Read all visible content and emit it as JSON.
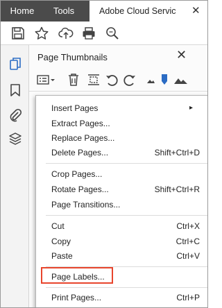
{
  "tabs": {
    "home": "Home",
    "tools": "Tools",
    "document": "Adobe Cloud Servic",
    "close": "✕"
  },
  "toolbar": {
    "icons": [
      "save-icon",
      "star-icon",
      "upload-cloud-icon",
      "print-icon",
      "zoom-search-icon"
    ]
  },
  "rail": {
    "icons": [
      "page-thumbnails-icon",
      "bookmark-icon",
      "attachment-icon",
      "layers-icon"
    ]
  },
  "panel": {
    "title": "Page Thumbnails",
    "close": "✕",
    "tools": [
      "options-menu-icon",
      "delete-icon",
      "insert-pages-icon",
      "rotate-left-icon",
      "rotate-right-icon",
      "small-thumbnails-icon",
      "thumbnail-size-slider-icon",
      "large-thumbnails-icon"
    ]
  },
  "menu": {
    "items": [
      {
        "label": "Insert Pages",
        "shortcut": "",
        "submenu": "▸"
      },
      {
        "label": "Extract Pages...",
        "shortcut": ""
      },
      {
        "label": "Replace Pages...",
        "shortcut": ""
      },
      {
        "label": "Delete Pages...",
        "shortcut": "Shift+Ctrl+D"
      },
      {
        "label": "Crop Pages...",
        "shortcut": ""
      },
      {
        "label": "Rotate Pages...",
        "shortcut": "Shift+Ctrl+R"
      },
      {
        "label": "Page Transitions...",
        "shortcut": ""
      },
      {
        "label": "Cut",
        "shortcut": "Ctrl+X"
      },
      {
        "label": "Copy",
        "shortcut": "Ctrl+C"
      },
      {
        "label": "Paste",
        "shortcut": "Ctrl+V"
      },
      {
        "label": "Page Labels...",
        "shortcut": ""
      },
      {
        "label": "Print Pages...",
        "shortcut": "Ctrl+P"
      }
    ]
  },
  "colors": {
    "tabbar": "#4b4b4b",
    "accent": "#2b6cc4",
    "highlight": "#e8452c"
  }
}
